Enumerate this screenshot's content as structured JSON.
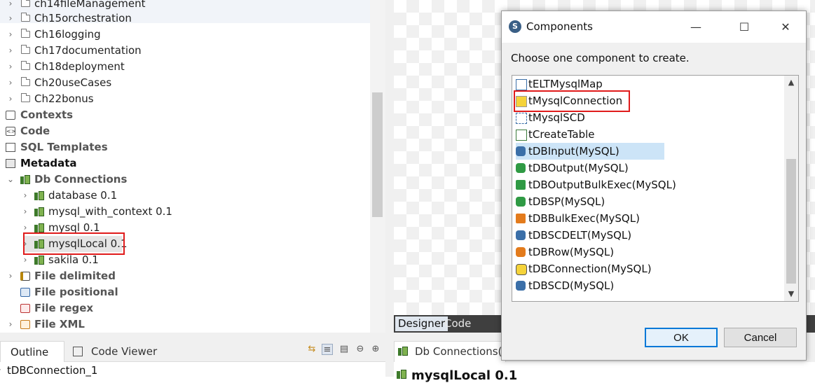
{
  "repository": {
    "items": [
      {
        "label": "ch14fileManagement",
        "type": "folder"
      },
      {
        "label": "Ch15orchestration",
        "type": "folder"
      },
      {
        "label": "Ch16logging",
        "type": "folder"
      },
      {
        "label": "Ch17documentation",
        "type": "folder"
      },
      {
        "label": "Ch18deployment",
        "type": "folder"
      },
      {
        "label": "Ch20useCases",
        "type": "folder"
      },
      {
        "label": "Ch22bonus",
        "type": "folder"
      },
      {
        "label": "Contexts",
        "type": "node"
      },
      {
        "label": "Code",
        "type": "node"
      },
      {
        "label": "SQL Templates",
        "type": "node"
      },
      {
        "label": "Metadata",
        "type": "node"
      },
      {
        "label": "Db Connections",
        "type": "node"
      },
      {
        "label": "database 0.1",
        "type": "db"
      },
      {
        "label": "mysql_with_context 0.1",
        "type": "db"
      },
      {
        "label": "mysql 0.1",
        "type": "db"
      },
      {
        "label": "mysqlLocal 0.1",
        "type": "db",
        "highlighted": true
      },
      {
        "label": "sakila 0.1",
        "type": "db"
      },
      {
        "label": "File delimited",
        "type": "node"
      },
      {
        "label": "File positional",
        "type": "node"
      },
      {
        "label": "File regex",
        "type": "node"
      },
      {
        "label": "File XML",
        "type": "node"
      }
    ]
  },
  "designer": {
    "tabs": [
      {
        "label": "Designer",
        "active": true
      },
      {
        "label": "Code",
        "active": false
      }
    ]
  },
  "bottom_left": {
    "tabs": [
      {
        "label": "Outline",
        "icon": "outline-icon",
        "active": true
      },
      {
        "label": "Code Viewer",
        "icon": "code-viewer-icon",
        "active": false
      }
    ],
    "tree_item": "tDBConnection_1"
  },
  "bottom_right": {
    "tab_label": "Db Connections(m",
    "content_title": "mysqlLocal 0.1"
  },
  "dialog": {
    "title": "Components",
    "prompt": "Choose one component to create.",
    "components": [
      {
        "label": "tELTMysqlMap",
        "icon": "elt-map-icon"
      },
      {
        "label": "tMysqlConnection",
        "icon": "connection-icon",
        "highlighted": true
      },
      {
        "label": "tMysqlSCD",
        "icon": "scd-icon"
      },
      {
        "label": "tCreateTable",
        "icon": "create-table-icon"
      },
      {
        "label": "tDBInput(MySQL)",
        "icon": "db-input-icon",
        "selected": true
      },
      {
        "label": "tDBOutput(MySQL)",
        "icon": "db-output-icon"
      },
      {
        "label": "tDBOutputBulkExec(MySQL)",
        "icon": "db-output-bulk-icon"
      },
      {
        "label": "tDBSP(MySQL)",
        "icon": "db-sp-icon"
      },
      {
        "label": "tDBBulkExec(MySQL)",
        "icon": "db-bulk-icon"
      },
      {
        "label": "tDBSCDELT(MySQL)",
        "icon": "db-scd-elt-icon"
      },
      {
        "label": "tDBRow(MySQL)",
        "icon": "db-row-icon"
      },
      {
        "label": "tDBConnection(MySQL)",
        "icon": "db-connection-icon"
      },
      {
        "label": "tDBSCD(MySQL)",
        "icon": "db-scd-icon"
      }
    ],
    "ok_label": "OK",
    "cancel_label": "Cancel"
  },
  "colors": {
    "highlight": "#e01b1b",
    "selection": "#cce4f7",
    "default_button_border": "#0078d7"
  }
}
